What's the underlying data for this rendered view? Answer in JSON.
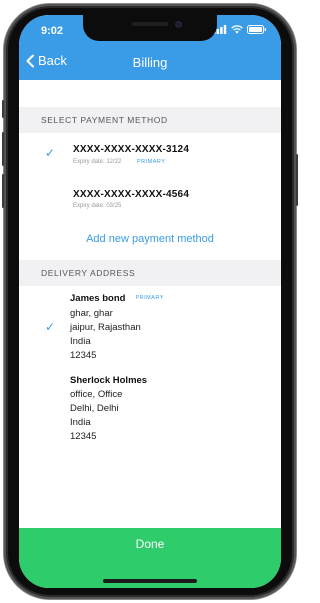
{
  "status": {
    "time": "9:02"
  },
  "header": {
    "back_label": "Back",
    "title": "Billing"
  },
  "payment": {
    "section_title": "SELECT PAYMENT METHOD",
    "cards": [
      {
        "number": "XXXX-XXXX-XXXX-3124",
        "expiry": "Expiry date: 12/22",
        "badge": "PRIMARY",
        "selected": true
      },
      {
        "number": "XXXX-XXXX-XXXX-4564",
        "expiry": "Expiry date: 03/25",
        "badge": "",
        "selected": false
      }
    ],
    "add_label": "Add new payment method"
  },
  "delivery": {
    "section_title": "DELIVERY ADDRESS",
    "addresses": [
      {
        "name": "James bond",
        "badge": "PRIMARY",
        "line1": "ghar, ghar",
        "line2": "jaipur, Rajasthan",
        "country": "India",
        "zip": "12345",
        "selected": true
      },
      {
        "name": "Sherlock Holmes",
        "line1": "office, Office",
        "line2": "Delhi, Delhi",
        "country": "India",
        "zip": "12345",
        "selected": false
      }
    ]
  },
  "footer": {
    "done_label": "Done"
  },
  "colors": {
    "accent": "#3a9ce6",
    "done": "#2ecc6b"
  },
  "icons": {
    "check": "check-icon",
    "back": "chevron-left-icon",
    "signal": "signal-icon",
    "wifi": "wifi-icon",
    "battery": "battery-icon"
  }
}
